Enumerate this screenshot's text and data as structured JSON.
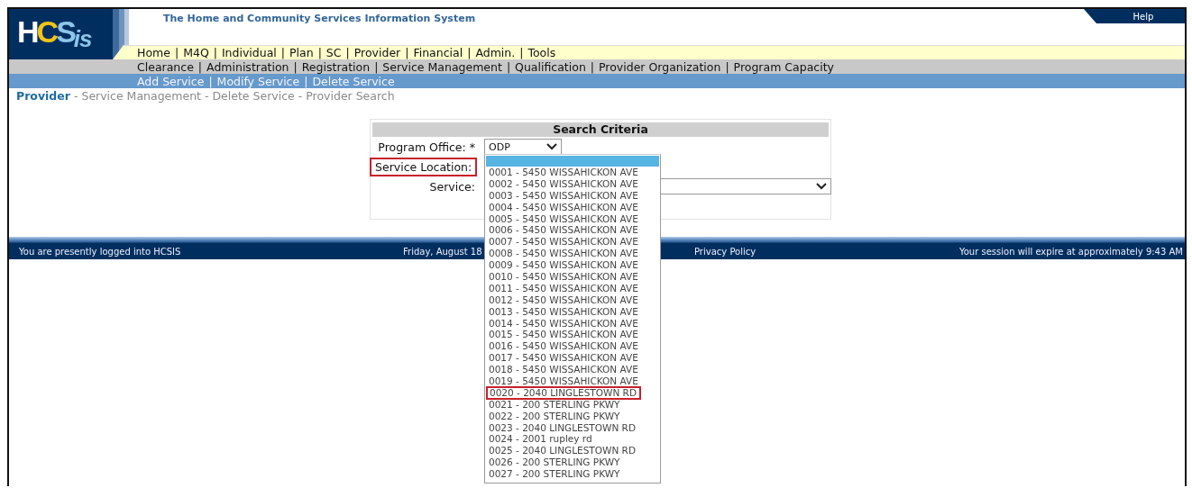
{
  "header": {
    "logo": {
      "letters": [
        {
          "text": "H",
          "color": "#ffffff"
        },
        {
          "text": "C",
          "color": "#f2c318"
        },
        {
          "text": "S",
          "color": "#8ec5ea"
        },
        {
          "text": "is",
          "color": "#8ec5ea"
        }
      ]
    },
    "title": "The Home and Community Services Information System",
    "help": "Help"
  },
  "menus": [
    {
      "kind": "primary",
      "separator": "|",
      "items": [
        "Home",
        "M4Q",
        "Individual",
        "Plan",
        "SC",
        "Provider",
        "Financial",
        "Admin.",
        "Tools"
      ]
    },
    {
      "kind": "secondary",
      "separator": "|",
      "items": [
        "Clearance",
        "Administration",
        "Registration",
        "Service Management",
        "Qualification",
        "Provider Organization",
        "Program Capacity"
      ]
    },
    {
      "kind": "tertiary",
      "separator": "|",
      "items": [
        "Add Service",
        "Modify Service",
        "Delete Service"
      ]
    }
  ],
  "breadcrumb": {
    "separator": "-",
    "items": [
      "Provider",
      "Service Management",
      "Delete Service",
      "Provider Search"
    ]
  },
  "search": {
    "title": "Search Criteria",
    "fields": [
      {
        "label": "Program Office: *",
        "kind": "select",
        "value": "ODP",
        "outlined": false
      },
      {
        "label": "Service Location:",
        "kind": "open-list",
        "outlined": true
      },
      {
        "label": "Service:",
        "kind": "select",
        "outlined": false
      }
    ]
  },
  "service_dropdown": {
    "blank_option_highlighted": true,
    "options": [
      {
        "label": "0001 - 5450 WISSAHICKON AVE",
        "outlined": false
      },
      {
        "label": "0002 - 5450 WISSAHICKON AVE",
        "outlined": false
      },
      {
        "label": "0003 - 5450 WISSAHICKON AVE",
        "outlined": false
      },
      {
        "label": "0004 - 5450 WISSAHICKON AVE",
        "outlined": false
      },
      {
        "label": "0005 - 5450 WISSAHICKON AVE",
        "outlined": false
      },
      {
        "label": "0006 - 5450 WISSAHICKON AVE",
        "outlined": false
      },
      {
        "label": "0007 - 5450 WISSAHICKON AVE",
        "outlined": false
      },
      {
        "label": "0008 - 5450 WISSAHICKON AVE",
        "outlined": false
      },
      {
        "label": "0009 - 5450 WISSAHICKON AVE",
        "outlined": false
      },
      {
        "label": "0010 - 5450 WISSAHICKON AVE",
        "outlined": false
      },
      {
        "label": "0011 - 5450 WISSAHICKON AVE",
        "outlined": false
      },
      {
        "label": "0012 - 5450 WISSAHICKON AVE",
        "outlined": false
      },
      {
        "label": "0013 - 5450 WISSAHICKON AVE",
        "outlined": false
      },
      {
        "label": "0014 - 5450 WISSAHICKON AVE",
        "outlined": false
      },
      {
        "label": "0015 - 5450 WISSAHICKON AVE",
        "outlined": false
      },
      {
        "label": "0016 - 5450 WISSAHICKON AVE",
        "outlined": false
      },
      {
        "label": "0017 - 5450 WISSAHICKON AVE",
        "outlined": false
      },
      {
        "label": "0018 - 5450 WISSAHICKON AVE",
        "outlined": false
      },
      {
        "label": "0019 - 5450 WISSAHICKON AVE",
        "outlined": false
      },
      {
        "label": "0020 - 2040 LINGLESTOWN RD",
        "outlined": true
      },
      {
        "label": "0021 - 200 STERLING PKWY",
        "outlined": false
      },
      {
        "label": "0022 - 200 STERLING PKWY",
        "outlined": false
      },
      {
        "label": "0023 - 2040 LINGLESTOWN RD",
        "outlined": false
      },
      {
        "label": "0024 - 2001 rupley rd",
        "outlined": false
      },
      {
        "label": "0025 - 2040 LINGLESTOWN RD",
        "outlined": false
      },
      {
        "label": "0026 - 200 STERLING PKWY",
        "outlined": false
      },
      {
        "label": "0027 - 200 STERLING PKWY",
        "outlined": false
      }
    ]
  },
  "footer": {
    "login": "You are presently logged into HCSIS",
    "date": "Friday, August 18",
    "privacy": "Privacy Policy",
    "session": "Your session will expire at approximately 9:43 AM"
  }
}
